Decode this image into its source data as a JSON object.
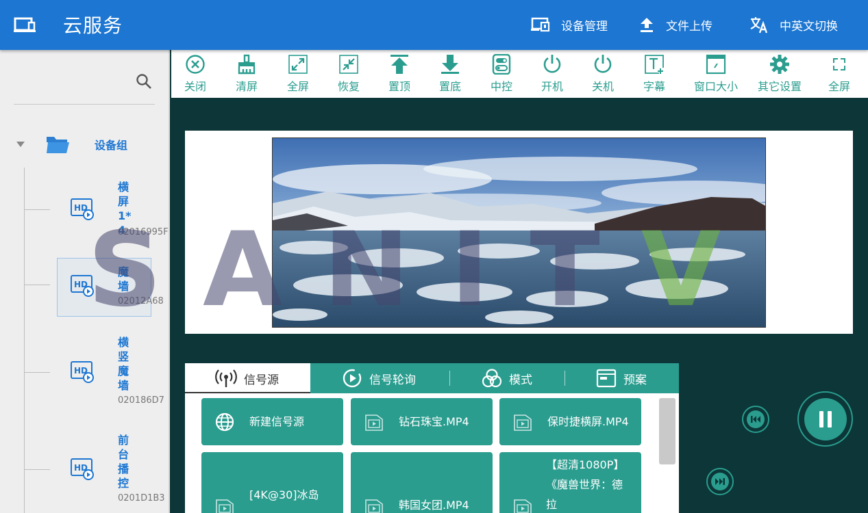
{
  "header": {
    "title": "云服务",
    "device_manage": "设备管理",
    "file_upload": "文件上传",
    "lang_switch": "中英文切换"
  },
  "sidebar": {
    "group_label": "设备组",
    "devices": [
      {
        "name": "横屏1*4",
        "id": "02016995F"
      },
      {
        "name": "魔墙",
        "id": "02012A68"
      },
      {
        "name": "横竖魔墙",
        "id": "020186D7"
      },
      {
        "name": "前台播控",
        "id": "0201D1B3"
      }
    ]
  },
  "toolbar": {
    "close": "关闭",
    "clear": "清屏",
    "fullscreen": "全屏",
    "restore": "恢复",
    "top": "置顶",
    "bottom": "置底",
    "central_control": "中控",
    "power_on": "开机",
    "power_off": "关机",
    "subtitle": "字幕",
    "window_size": "窗口大小",
    "other_settings": "其它设置",
    "fullscreen2": "全屏"
  },
  "watermark": {
    "text_a": "SAN",
    "text_b": "IT",
    "text_c": "V"
  },
  "tabs": [
    {
      "label": "信号源",
      "active": true
    },
    {
      "label": "信号轮询"
    },
    {
      "label": "模式"
    },
    {
      "label": "预案"
    }
  ],
  "sources": [
    {
      "label": "新建信号源",
      "icon": "globe-icon"
    },
    {
      "label": "钻石珠宝.MP4",
      "icon": "video-file-icon"
    },
    {
      "label": "保时捷横屏.MP4",
      "icon": "video-file-icon"
    },
    {
      "label": "[4K@30]冰岛",
      "icon": "video-file-icon"
    },
    {
      "label": "韩国女团.MP4",
      "icon": "video-file-icon"
    },
    {
      "label": "【超清1080P】《魔兽世界：德拉",
      "icon": "video-file-icon"
    }
  ],
  "colors": {
    "header": "#1c76d2",
    "accent": "#2a9d8f",
    "background": "#0c3637"
  }
}
